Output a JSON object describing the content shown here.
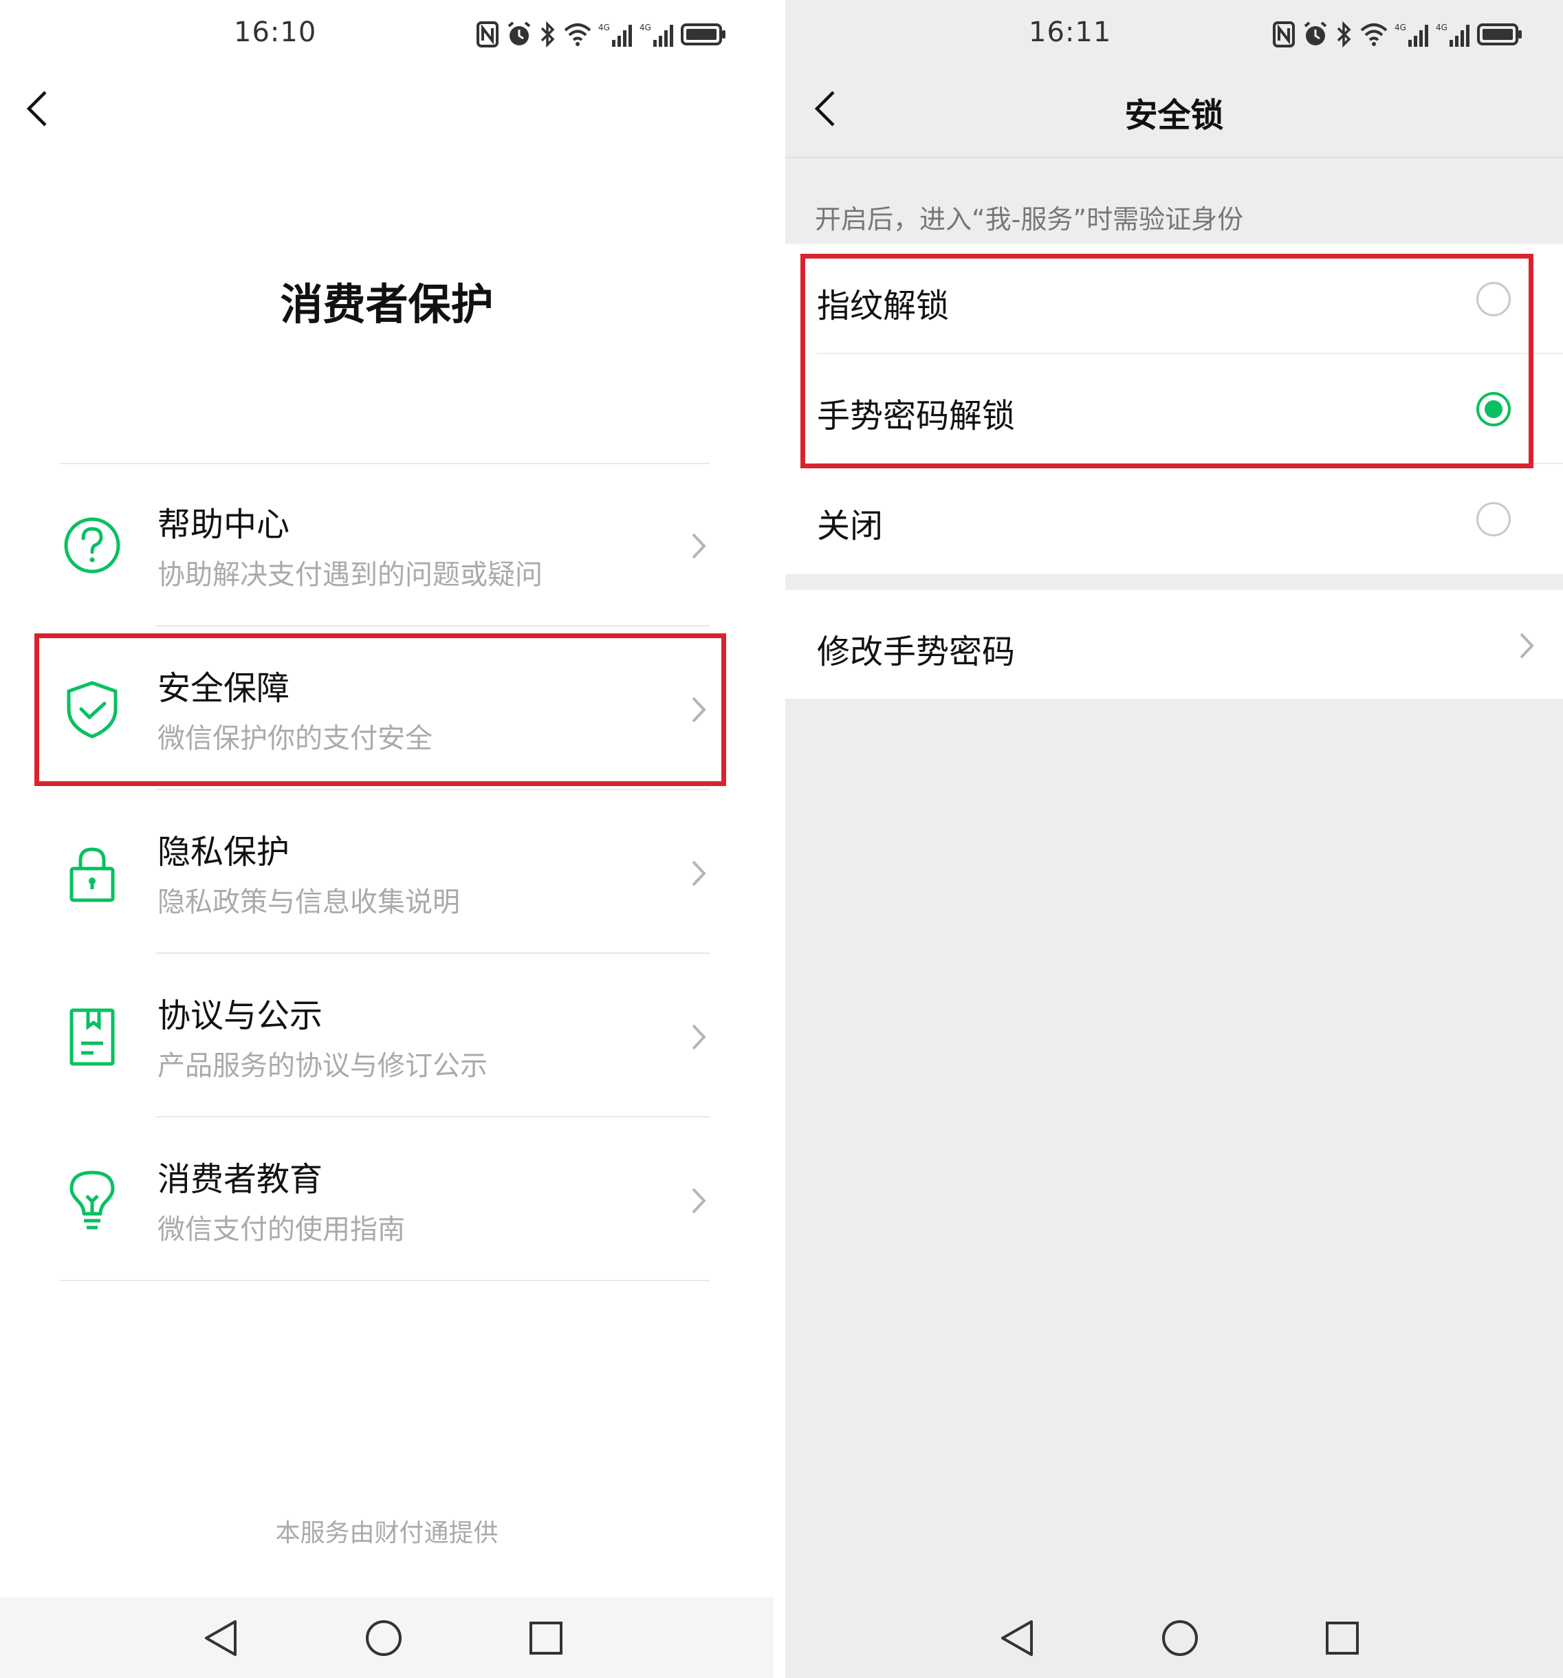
{
  "left": {
    "status": {
      "time": "16:10"
    },
    "title": "消费者保护",
    "menu": [
      {
        "title": "帮助中心",
        "subtitle": "协助解决支付遇到的问题或疑问",
        "icon": "question-circle-icon"
      },
      {
        "title": "安全保障",
        "subtitle": "微信保护你的支付安全",
        "icon": "shield-check-icon"
      },
      {
        "title": "隐私保护",
        "subtitle": "隐私政策与信息收集说明",
        "icon": "lock-icon"
      },
      {
        "title": "协议与公示",
        "subtitle": "产品服务的协议与修订公示",
        "icon": "document-icon"
      },
      {
        "title": "消费者教育",
        "subtitle": "微信支付的使用指南",
        "icon": "lightbulb-icon"
      }
    ],
    "footer": "本服务由财付通提供"
  },
  "right": {
    "status": {
      "time": "16:11"
    },
    "title": "安全锁",
    "hint": "开启后，进入“我-服务”时需验证身份",
    "options": [
      {
        "label": "指纹解锁",
        "selected": false
      },
      {
        "label": "手势密码解锁",
        "selected": true
      },
      {
        "label": "关闭",
        "selected": false
      }
    ],
    "change_gesture": "修改手势密码"
  },
  "colors": {
    "accent_green": "#07c160",
    "highlight_red": "#d8242f",
    "subtitle_gray": "#aaaaaa"
  }
}
